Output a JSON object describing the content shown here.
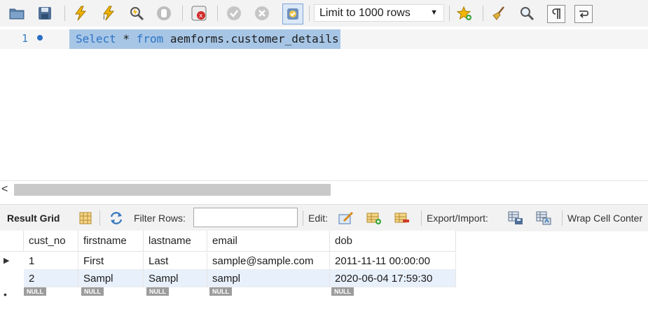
{
  "toolbar": {
    "limit_select": "Limit to 1000 rows",
    "icons": [
      "open-folder-icon",
      "save-icon",
      "execute-icon",
      "execute-current-icon",
      "explain-icon",
      "stop-icon",
      "toggle-error-icon",
      "commit-icon",
      "rollback-icon",
      "autocommit-icon",
      "bookmark-icon",
      "beautify-icon",
      "find-icon",
      "invisibles-icon",
      "wrap-icon"
    ]
  },
  "editor": {
    "line_number": "1",
    "sql": {
      "kw_select": "Select",
      "star": " * ",
      "kw_from": "from",
      "rest": " aemforms.customer_details"
    }
  },
  "scrollbar": {
    "left_arrow": "<"
  },
  "result_toolbar": {
    "title": "Result Grid",
    "filter_label": "Filter Rows:",
    "filter_value": "",
    "edit_label": "Edit:",
    "export_label": "Export/Import:",
    "wrap_label": "Wrap Cell Conter"
  },
  "grid": {
    "columns": [
      "cust_no",
      "firstname",
      "lastname",
      "email",
      "dob"
    ],
    "rows": [
      [
        "1",
        "First",
        "Last",
        "sample@sample.com",
        "2011-11-11 00:00:00"
      ],
      [
        "2",
        "Sampl",
        "Sampl",
        "sampl",
        "2020-06-04 17:59:30"
      ]
    ],
    "null_label": "NULL",
    "current_row_marker": "▶",
    "new_row_marker": "•"
  },
  "colors": {
    "selection": "#a7c6e6",
    "keyword": "#2d73c5",
    "null_badge": "#9c9c9c"
  }
}
